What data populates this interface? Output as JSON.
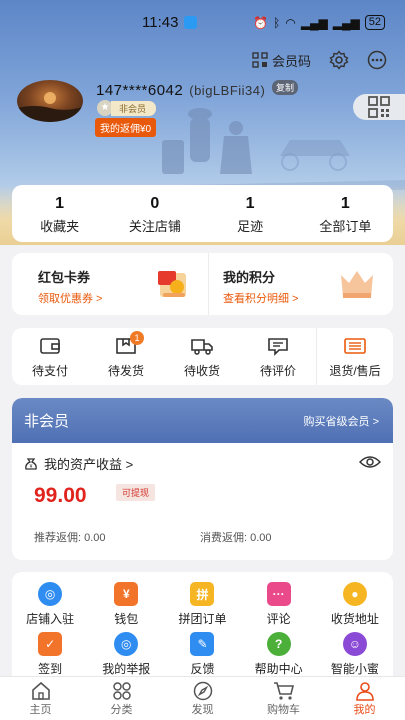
{
  "status_bar": {
    "time": "11:43",
    "battery": "52",
    "icons": [
      "alarm-icon",
      "bluetooth-icon",
      "wifi-icon",
      "4g-signal-icon",
      "5g-signal-icon"
    ]
  },
  "header": {
    "member_code_label": "会员码",
    "username": "147****6042",
    "nickname": "(bigLBFii34)",
    "copy_label": "复制",
    "member_level": "非会员",
    "rebate_label": "我的返佣¥0"
  },
  "stats": [
    {
      "value": "1",
      "label": "收藏夹"
    },
    {
      "value": "0",
      "label": "关注店铺"
    },
    {
      "value": "1",
      "label": "足迹"
    },
    {
      "value": "1",
      "label": "全部订单"
    }
  ],
  "promo": {
    "left": {
      "title": "红包卡券",
      "sub": "领取优惠券 >"
    },
    "right": {
      "title": "我的积分",
      "sub": "查看积分明细 >"
    }
  },
  "orders": [
    {
      "label": "待支付",
      "icon": "wallet-icon"
    },
    {
      "label": "待发货",
      "icon": "package-icon",
      "badge": "1"
    },
    {
      "label": "待收货",
      "icon": "truck-icon"
    },
    {
      "label": "待评价",
      "icon": "comment-icon"
    },
    {
      "label": "退货/售后",
      "icon": "refund-icon"
    }
  ],
  "assets": {
    "band_title": "非会员",
    "band_link": "购买省级会员 >",
    "title": "我的资产收益 >",
    "amount": "99.00",
    "withdraw_label": "可提现",
    "referral_rebate": "推荐返佣:  0.00",
    "consume_rebate": "消费返佣:  0.00"
  },
  "services": [
    {
      "label": "店铺入驻",
      "icon": "store-join-icon",
      "color": "#2f8cf0",
      "glyph": "◎"
    },
    {
      "label": "钱包",
      "icon": "wallet-icon",
      "color": "#f2732a",
      "glyph": "¥"
    },
    {
      "label": "拼团订单",
      "icon": "group-order-icon",
      "color": "#f6b624",
      "glyph": "拼"
    },
    {
      "label": "评论",
      "icon": "comment-icon",
      "color": "#ea4a8a",
      "glyph": "···"
    },
    {
      "label": "收货地址",
      "icon": "address-icon",
      "color": "#f6b624",
      "glyph": "●"
    },
    {
      "label": "签到",
      "icon": "checkin-icon",
      "color": "#f2732a",
      "glyph": "✓"
    },
    {
      "label": "我的举报",
      "icon": "report-icon",
      "color": "#2f8cf0",
      "glyph": "◎"
    },
    {
      "label": "反馈",
      "icon": "feedback-icon",
      "color": "#2f8cf0",
      "glyph": "✎"
    },
    {
      "label": "帮助中心",
      "icon": "help-icon",
      "color": "#4caf3a",
      "glyph": "?"
    },
    {
      "label": "智能小蜜",
      "icon": "assistant-icon",
      "color": "#8b4ad6",
      "glyph": "☺"
    }
  ],
  "tabs": [
    {
      "label": "主页",
      "icon": "home-icon"
    },
    {
      "label": "分类",
      "icon": "category-icon"
    },
    {
      "label": "发现",
      "icon": "compass-icon"
    },
    {
      "label": "购物车",
      "icon": "cart-icon"
    },
    {
      "label": "我的",
      "icon": "profile-icon",
      "active": true
    }
  ]
}
